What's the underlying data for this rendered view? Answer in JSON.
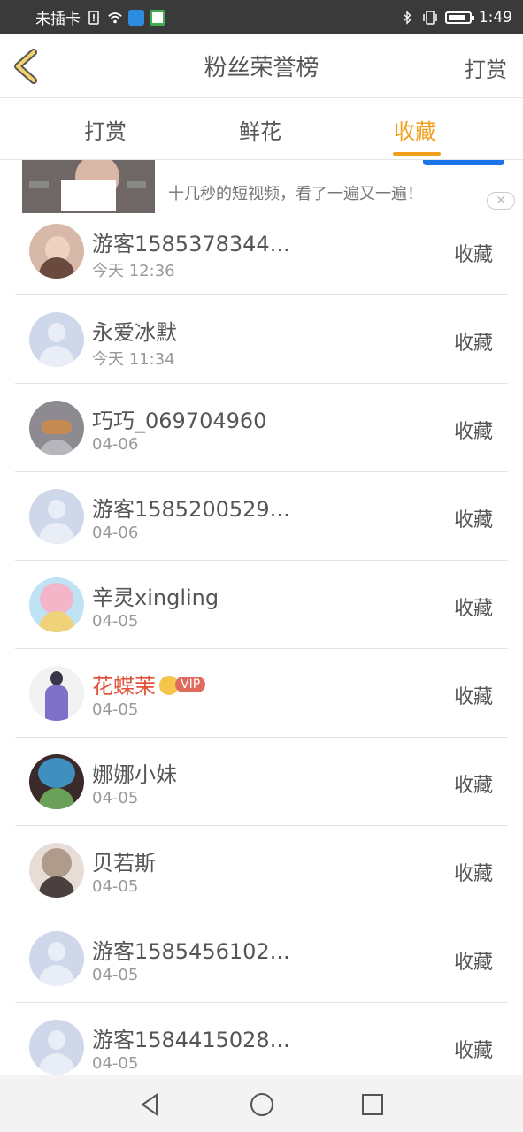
{
  "status_bar": {
    "carrier": "未插卡",
    "time": "1:49",
    "icons": [
      "sim-alert-icon",
      "wifi-icon",
      "app-notification-icon",
      "app-notification-icon-2",
      "bluetooth-icon",
      "vibrate-icon",
      "battery-icon"
    ]
  },
  "header": {
    "title": "粉丝荣誉榜",
    "action_label": "打赏",
    "back_icon": "chevron-left-icon",
    "back_color": "#f0a01c"
  },
  "tabs": [
    {
      "label": "打赏",
      "active": false
    },
    {
      "label": "鲜花",
      "active": false
    },
    {
      "label": "收藏",
      "active": true
    }
  ],
  "accent_color": "#f0a01c",
  "ad": {
    "text": "十几秒的短视频，看了一遍又一遍！",
    "close_icon": "close-icon"
  },
  "list": [
    {
      "name": "游客1585378344...",
      "time": "今天 12:36",
      "action": "收藏",
      "avatar": "photo"
    },
    {
      "name": "永爱冰默",
      "time": "今天 11:34",
      "action": "收藏",
      "avatar": "default"
    },
    {
      "name": "巧巧_069704960",
      "time": "04-06",
      "action": "收藏",
      "avatar": "photo"
    },
    {
      "name": "游客1585200529...",
      "time": "04-06",
      "action": "收藏",
      "avatar": "default"
    },
    {
      "name": "辛灵xingling",
      "time": "04-05",
      "action": "收藏",
      "avatar": "photo"
    },
    {
      "name": "花蝶茉",
      "time": "04-05",
      "action": "收藏",
      "avatar": "photo",
      "vip": true,
      "vip_label": "VIP"
    },
    {
      "name": "娜娜小妹",
      "time": "04-05",
      "action": "收藏",
      "avatar": "photo"
    },
    {
      "name": "贝若斯",
      "time": "04-05",
      "action": "收藏",
      "avatar": "photo"
    },
    {
      "name": "游客1585456102...",
      "time": "04-05",
      "action": "收藏",
      "avatar": "default"
    },
    {
      "name": "游客1584415028...",
      "time": "04-05",
      "action": "收藏",
      "avatar": "default"
    }
  ],
  "nav_bar": {
    "icons": [
      "back-triangle-icon",
      "home-circle-icon",
      "recents-square-icon"
    ]
  }
}
